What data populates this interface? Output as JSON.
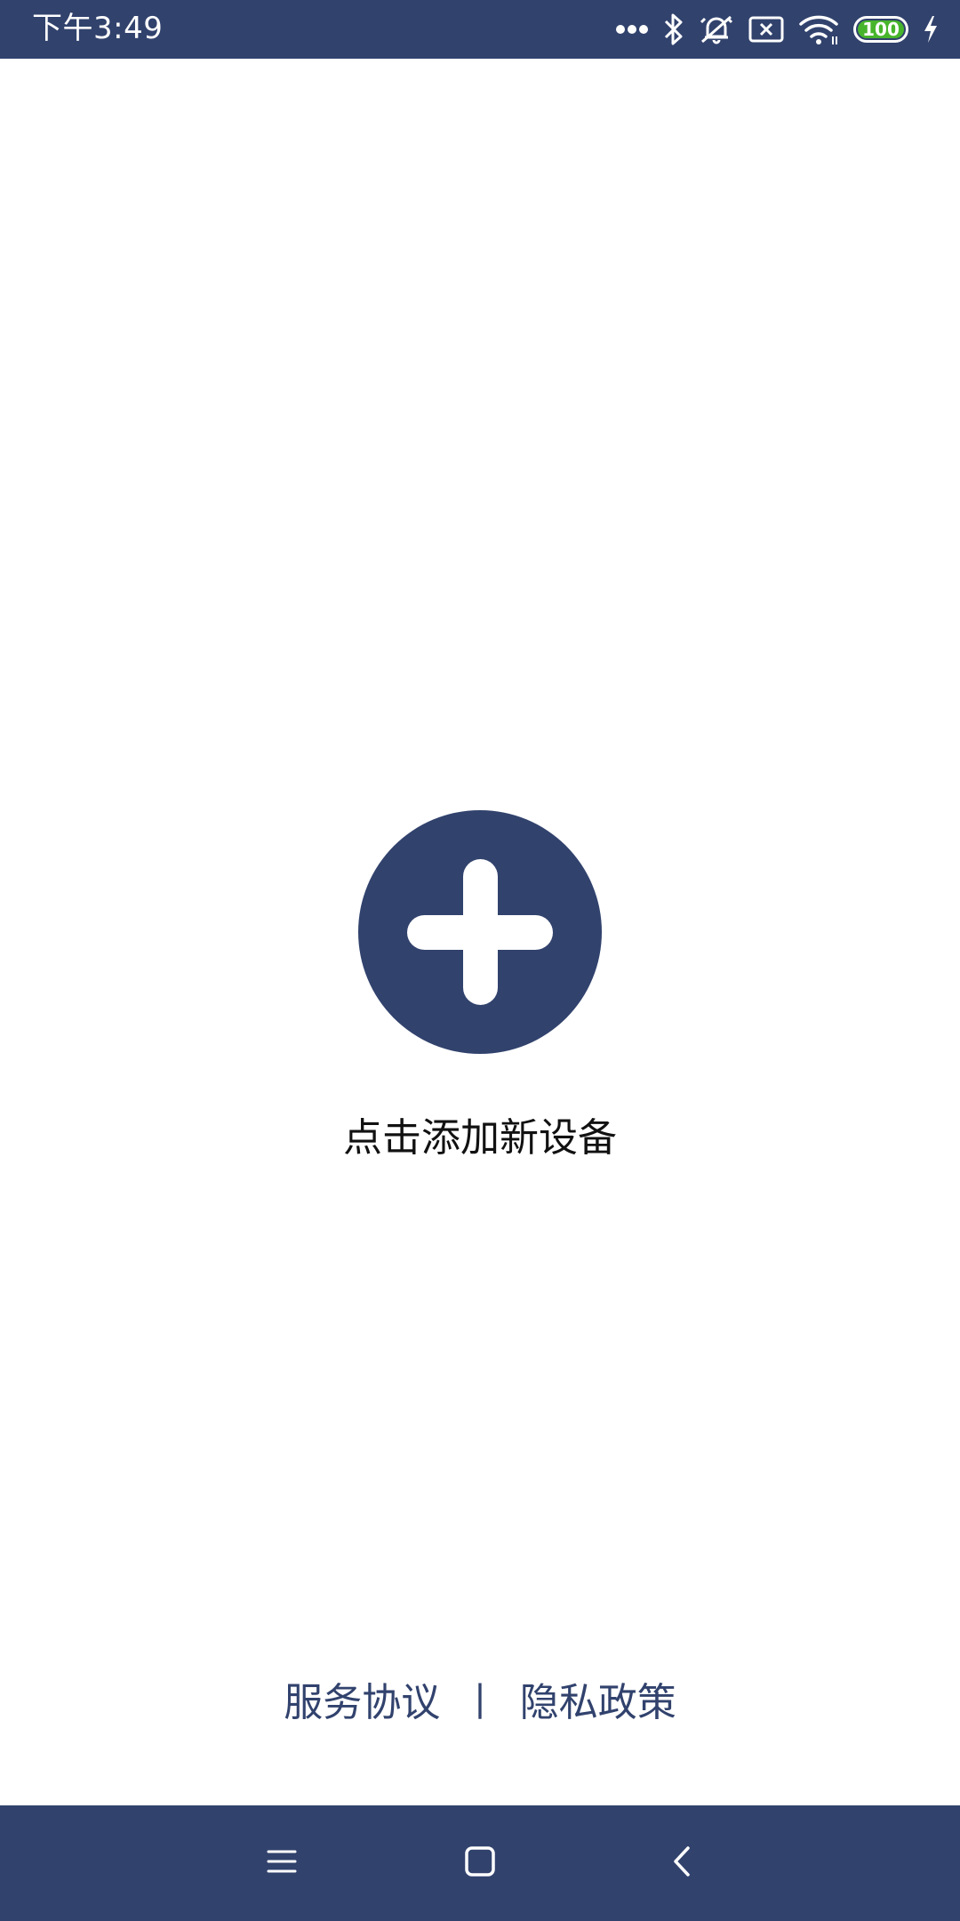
{
  "status_bar": {
    "time": "下午3:49",
    "battery_level": "100",
    "icons": [
      "more-dots-icon",
      "bluetooth-icon",
      "alarm-off-icon",
      "no-sim-icon",
      "wifi-icon",
      "battery-icon",
      "charging-icon"
    ]
  },
  "main": {
    "add_device_label": "点击添加新设备",
    "add_icon": "plus-circle-icon"
  },
  "footer": {
    "service_agreement": "服务协议",
    "separator": "|",
    "privacy_policy": "隐私政策"
  },
  "nav_bar": {
    "icons": [
      "menu-icon",
      "home-icon",
      "back-icon"
    ]
  },
  "colors": {
    "brand": "#31426d",
    "battery": "#47b52c",
    "background": "#ffffff"
  }
}
